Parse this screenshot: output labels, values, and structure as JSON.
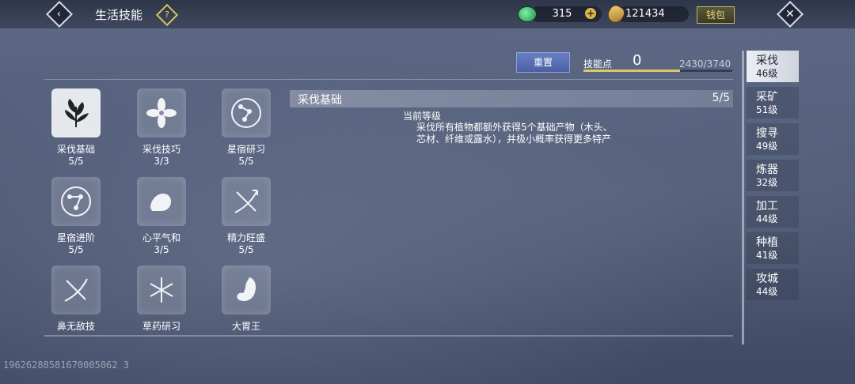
{
  "header": {
    "title": "生活技能",
    "help_icon": "question-icon",
    "jade_amount": "315",
    "gold_amount": "121434",
    "wallet_label": "钱包"
  },
  "skill_points": {
    "reset_label": "重置",
    "label": "技能点",
    "value": "0",
    "progress_text": "2430/3740",
    "progress_fraction": 0.65
  },
  "skills": [
    {
      "name": "采伐基础",
      "level": "5/5",
      "icon": "leaf-icon",
      "selected": true
    },
    {
      "name": "采伐技巧",
      "level": "3/3",
      "icon": "flower-icon"
    },
    {
      "name": "星宿研习",
      "level": "5/5",
      "icon": "constellation-icon"
    },
    {
      "name": "星宿进阶",
      "level": "5/5",
      "icon": "constellation-icon"
    },
    {
      "name": "心平气和",
      "level": "3/5",
      "icon": "arm-icon"
    },
    {
      "name": "精力旺盛",
      "level": "5/5",
      "icon": "bow-icon"
    },
    {
      "name": "鼻无敌技",
      "level": "",
      "icon": "bow-icon"
    },
    {
      "name": "草药研习",
      "level": "",
      "icon": "herb-icon"
    },
    {
      "name": "大胃王",
      "level": "",
      "icon": "stomach-icon"
    }
  ],
  "detail": {
    "title": "采伐基础",
    "level": "5/5",
    "current_label": "当前等级",
    "description": "采伐所有植物都额外获得5个基础产物（木头、芯材、纤维或露水），并极小概率获得更多特产"
  },
  "tabs": [
    {
      "name": "采伐",
      "level": "46级",
      "active": true
    },
    {
      "name": "采矿",
      "level": "51级"
    },
    {
      "name": "搜寻",
      "level": "49级"
    },
    {
      "name": "炼器",
      "level": "32级"
    },
    {
      "name": "加工",
      "level": "44级"
    },
    {
      "name": "种植",
      "level": "41级"
    },
    {
      "name": "攻城",
      "level": "44级"
    }
  ],
  "footer_id": "19626288581670005062 3"
}
